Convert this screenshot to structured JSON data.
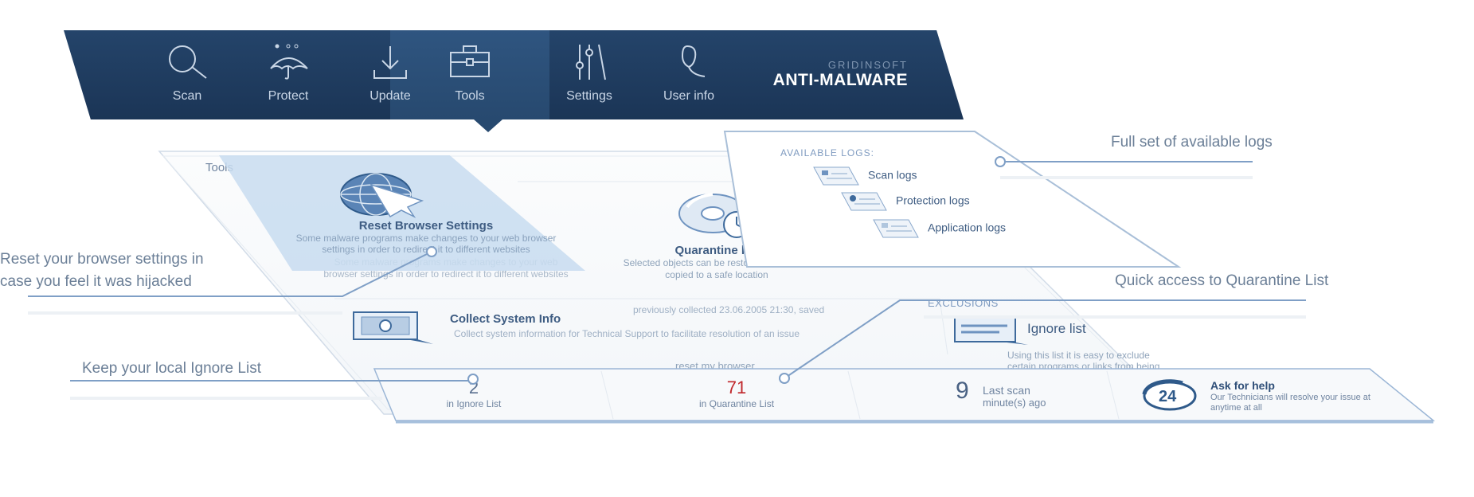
{
  "nav": {
    "items": [
      {
        "label": "Scan",
        "icon": "magnifier-icon"
      },
      {
        "label": "Protect",
        "icon": "umbrella-icon"
      },
      {
        "label": "Update",
        "icon": "download-icon"
      },
      {
        "label": "Tools",
        "icon": "toolbox-icon",
        "active": true
      },
      {
        "label": "Settings",
        "icon": "sliders-icon"
      },
      {
        "label": "User info",
        "icon": "user-icon"
      }
    ],
    "brand_top": "GRIDINSOFT",
    "brand_bottom": "ANTI-MALWARE"
  },
  "tools": {
    "title": "Tools",
    "reset": {
      "title": "Reset Browser Settings",
      "desc": "Some malware programs make changes to your web browser settings in order to redirect it to different websites"
    },
    "reset_ghost": "Some malware programs make changes to your web browser settings in order to redirect it to different websites",
    "quarantine": {
      "title": "Quarantine list",
      "desc": "Selected objects can be restored, deleted or copied to a safe location"
    },
    "collect": {
      "title": "Collect System Info",
      "previous": "previously collected 23.06.2005 21:30, saved",
      "desc": "Collect system information for Technical Support to facilitate resolution of an issue"
    },
    "exclusions": {
      "heading": "EXCLUSIONS",
      "title": "Ignore list",
      "desc": "Using this list it is easy to exclude certain programs or links from being detected in"
    },
    "reset_link": "reset my browser"
  },
  "logs": {
    "heading": "AVAILABLE LOGS:",
    "items": [
      "Scan logs",
      "Protection logs",
      "Application logs"
    ]
  },
  "stats": {
    "ignore_count": "2",
    "ignore_label": "in Ignore List",
    "quarantine_count": "71",
    "quarantine_label": "in Quarantine List",
    "last_scan_value": "9",
    "last_scan_label": "Last scan",
    "last_scan_unit": "minute(s) ago",
    "help_badge": "24",
    "help_title": "Ask for help",
    "help_desc": "Our Technicians will resolve your issue at anytime at all"
  },
  "callouts": {
    "logs": "Full set of available logs",
    "reset": "Reset your browser settings in case you feel it was hijacked",
    "quarantine": "Quick access to Quarantine List",
    "ignore": "Keep your local Ignore List"
  },
  "colors": {
    "nav_bg": "#1b3556",
    "accent": "#6e93c0",
    "quarantine_count": "#c0282c"
  }
}
